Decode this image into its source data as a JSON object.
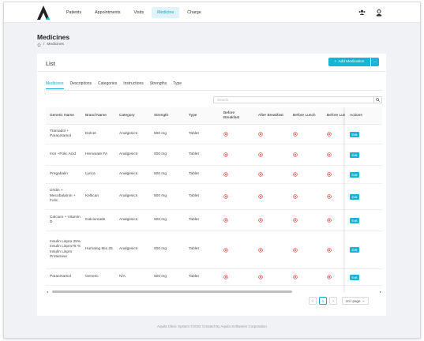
{
  "nav": {
    "items": [
      "Patients",
      "Appointments",
      "Visits",
      "Medicine",
      "Charge"
    ],
    "active_index": 3
  },
  "header_icons": [
    "users-group-icon",
    "user-icon"
  ],
  "page": {
    "title": "Medicines",
    "breadcrumb": [
      "Medicines"
    ]
  },
  "card": {
    "title": "List",
    "add_button_label": "Add Medication",
    "more_label": "···"
  },
  "tabs": {
    "items": [
      "Medicines",
      "Descriptions",
      "Categories",
      "Instructions",
      "Strengths",
      "Type"
    ],
    "active_index": 0
  },
  "search": {
    "placeholder": "Search"
  },
  "table": {
    "columns": [
      "Generic Name",
      "Brand Name",
      "Category",
      "Strength",
      "Type",
      "Before Breakfast",
      "After Breakfast",
      "Before Lunch",
      "Before Lun",
      "Actions"
    ],
    "rows": [
      {
        "generic": "Tramadol + Paracetamol",
        "brand": "Dolcet",
        "category": "Analgesics",
        "strength": "500 mg",
        "type": "Tablet",
        "before_breakfast": "no",
        "after_breakfast": "no",
        "before_lunch": "no",
        "col_before_lun": "no",
        "action": "Edit"
      },
      {
        "generic": "Iron +Folic Acid",
        "brand": "Hemarate FA",
        "category": "Analgesics",
        "strength": "500 mg",
        "type": "Tablet",
        "before_breakfast": "no",
        "after_breakfast": "no",
        "before_lunch": "no",
        "col_before_lun": "no",
        "action": "Edit"
      },
      {
        "generic": "Pregabalin",
        "brand": "Lyrica",
        "category": "Analgesics",
        "strength": "500 mg",
        "type": "Tablet",
        "before_breakfast": "no",
        "after_breakfast": "no",
        "before_lunch": "no",
        "col_before_lun": "no",
        "action": "Edit"
      },
      {
        "generic": "Uridin + Mecobalamin + Folic",
        "brand": "Keltican",
        "category": "Analgesics",
        "strength": "500 mg",
        "type": "Tablet",
        "before_breakfast": "no",
        "after_breakfast": "no",
        "before_lunch": "no",
        "col_before_lun": "no",
        "action": "Edit"
      },
      {
        "generic": "Calcium + Vitamin D",
        "brand": "Calciumade",
        "category": "Analgesics",
        "strength": "500 mg",
        "type": "Tablet",
        "before_breakfast": "no",
        "after_breakfast": "no",
        "before_lunch": "no",
        "col_before_lun": "no",
        "action": "Edit"
      },
      {
        "generic": "Insulin Lispro 25% Insulin Lispro75 % Insulin Lispro Protamine",
        "brand": "Humalog Mix 25",
        "category": "Analgesics",
        "strength": "500 mg",
        "type": "Tablet",
        "before_breakfast": "no",
        "after_breakfast": "no",
        "before_lunch": "no",
        "col_before_lun": "no",
        "action": "Edit"
      },
      {
        "generic": "Paracetamol",
        "brand": "Generic",
        "category": "N/A",
        "strength": "500 mg",
        "type": "Tablet",
        "before_breakfast": "no",
        "after_breakfast": "no",
        "before_lunch": "no",
        "col_before_lun": "no",
        "action": "Edit"
      }
    ]
  },
  "pagination": {
    "prev": "<",
    "current": "1",
    "next": ">",
    "page_size": "10 / page"
  },
  "footer": "Aquila Clinic System ©2022 Created By Aquila Softwares Corporation",
  "colors": {
    "accent": "#17b4d6",
    "no_icon": "#e53935"
  }
}
